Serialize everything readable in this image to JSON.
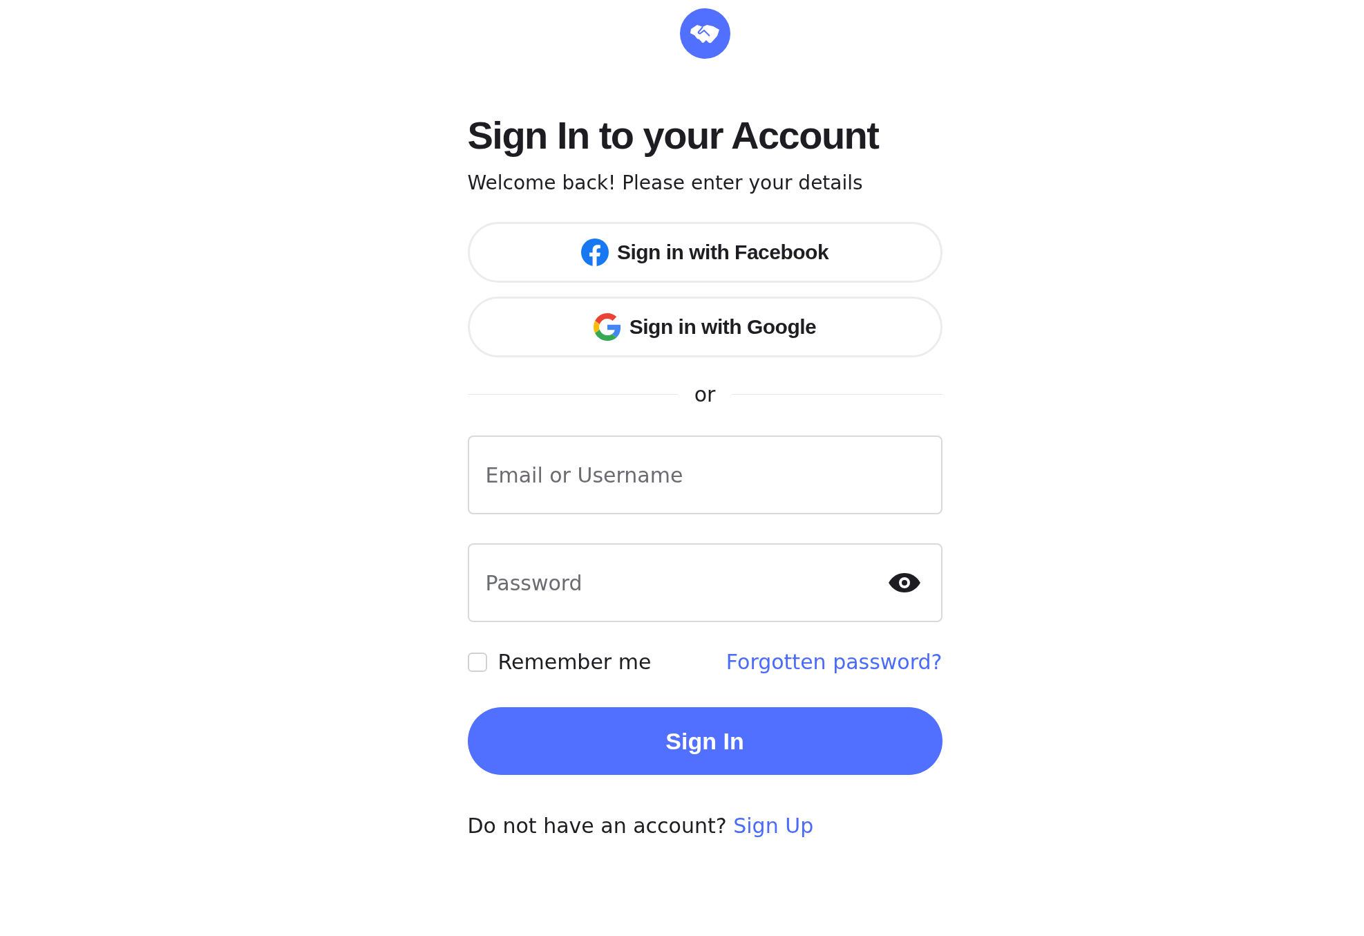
{
  "title": "Sign In to your Account",
  "subtitle": "Welcome back! Please enter your details",
  "social_buttons": [
    {
      "kind": "facebook",
      "label": "Sign in with Facebook"
    },
    {
      "kind": "google",
      "label": "Sign in with Google"
    }
  ],
  "divider": "or",
  "email": {
    "placeholder": "Email or Username"
  },
  "password": {
    "placeholder": "Password"
  },
  "remember": {
    "label": "Remember me",
    "checked": false
  },
  "forgot_link": "Forgotten password?",
  "submit": "Sign In",
  "footer": {
    "text": "Do not have an account?",
    "link": "Sign Up"
  }
}
